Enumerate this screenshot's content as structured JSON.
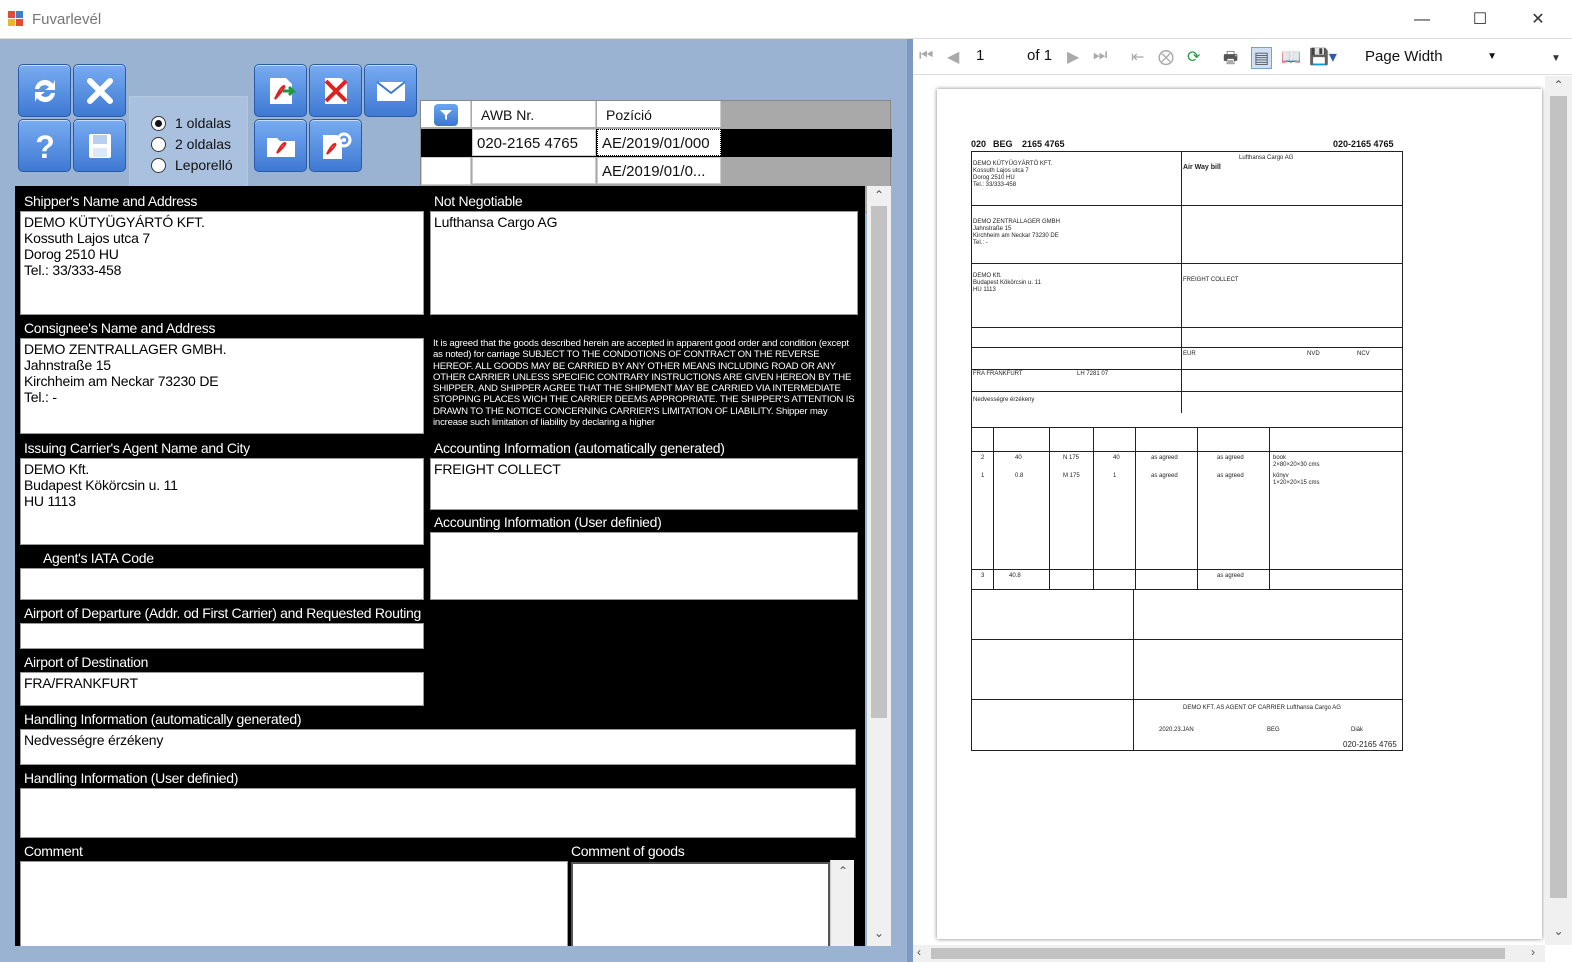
{
  "window": {
    "title": "Fuvarlevél"
  },
  "toolbar": {
    "radio_options": [
      {
        "label": "1 oldalas",
        "checked": true
      },
      {
        "label": "2 oldalas",
        "checked": false
      },
      {
        "label": "Leporelló",
        "checked": false
      }
    ]
  },
  "grid": {
    "headers": [
      "AWB Nr.",
      "Pozíció"
    ],
    "rows": [
      {
        "awb": "020-2165 4765",
        "position": "AE/2019/01/000"
      },
      {
        "awb": "",
        "position": "AE/2019/01/0..."
      }
    ]
  },
  "form": {
    "shipper_label": "Shipper's Name and Address",
    "shipper_value": "DEMO KÜTYÜGYÁRTÓ KFT.\nKossuth Lajos utca 7\nDorog  2510 HU\nTel.: 33/333-458",
    "not_negotiable_label": "Not Negotiable",
    "not_negotiable_value": "Lufthansa Cargo AG",
    "consignee_label": "Consignee's Name and Address",
    "consignee_value": "DEMO ZENTRALLAGER GMBH.\nJahnstraße 15\nKirchheim am Neckar  73230 DE\nTel.: -",
    "terms_text": "It is agreed that the goods described herein are accepted in apparent good order and condition (except as noted) for carriage SUBJECT TO THE CONDOTIONS OF CONTRACT ON THE REVERSE HEREOF. ALL GOODS MAY BE CARRIED BY ANY OTHER MEANS INCLUDING ROAD OR ANY OTHER CARRIER UNLESS SPECIFIC CONTRARY INSTRUCTIONS ARE GIVEN HEREON BY THE SHIPPER, AND SHIPPER AGREE THAT THE SHIPMENT MAY BE CARRIED VIA INTERMEDIATE STOPPING PLACES WICH THE CARRIER DEEMS APPROPRIATE. THE SHIPPER'S ATTENTION IS DRAWN TO THE NOTICE CONCERNING CARRIER'S LIMITATION OF LIABILITY. Shipper may increase such limitation of liability by declaring a higher",
    "agent_label": "Issuing Carrier's Agent Name and City",
    "agent_value": "DEMO Kft.\nBudapest Kökörcsin u. 11\nHU 1113",
    "acc_auto_label": "Accounting Information (automatically generated)",
    "acc_auto_value": "FREIGHT COLLECT",
    "acc_user_label": "Accounting Information (User definied)",
    "acc_user_value": "",
    "iata_label": "Agent's IATA Code",
    "iata_value": "",
    "departure_label": "Airport of Departure (Addr. od First Carrier) and Requested Routing",
    "departure_value": "",
    "destination_label": "Airport of Destination",
    "destination_value": "FRA/FRANKFURT",
    "handling_auto_label": "Handling Information (automatically generated)",
    "handling_auto_value": "Nedvességre érzékeny",
    "handling_user_label": "Handling Information (User definied)",
    "handling_user_value": "",
    "comment_label": "Comment",
    "comment_value": "",
    "comment_goods_label": "Comment of goods",
    "comment_goods_value": ""
  },
  "viewer": {
    "page_current": "1",
    "page_of": "of",
    "page_total": "1",
    "zoom": "Page Width"
  },
  "awb_preview": {
    "prefix": "020",
    "origin": "BEG",
    "number": "2165 4765",
    "full_number": "020-2165 4765",
    "shipper": "DEMO KÜTYÜGYÁRTÓ KFT.\nKossuth Lajos utca 7\nDorog 2510 HU\nTel.: 33/333-458",
    "issuer": "Lufthansa Cargo AG",
    "title": "Air Way bill",
    "consignee": "DEMO ZENTRALLAGER GMBH\nJahnstraße 15\nKirchheim am Neckar 73230 DE\nTel.: -",
    "agent": "DEMO Kft.\nBudapest Kökörcsin u. 11\nHU 1113",
    "accounting": "FREIGHT COLLECT",
    "handling": "Nedvességre érzékeny",
    "currency": "EUR",
    "declared_carriage": "NVD",
    "declared_customs": "NCV",
    "destination": "FRA FRANKFURT",
    "flight": "LH 7281 07",
    "rows": [
      {
        "pieces": "2",
        "weight": "40",
        "rate_class": "N 175",
        "chargeable": "40",
        "rate": "as agreed",
        "total": "as agreed",
        "goods": "book\n2×80×20×30 cms"
      },
      {
        "pieces": "1",
        "weight": "0.8",
        "rate_class": "M 175",
        "chargeable": "1",
        "rate": "as agreed",
        "total": "as agreed",
        "goods": "könyv\n1×20×20×15 cms"
      }
    ],
    "total_pieces": "3",
    "total_weight": "40.8",
    "total_charge": "as agreed",
    "signature_line": "DEMO KFT. AS AGENT OF CARRIER Lufthansa Cargo AG",
    "date": "2020.23.JAN",
    "place": "BEG",
    "sign_short": "Diák"
  }
}
